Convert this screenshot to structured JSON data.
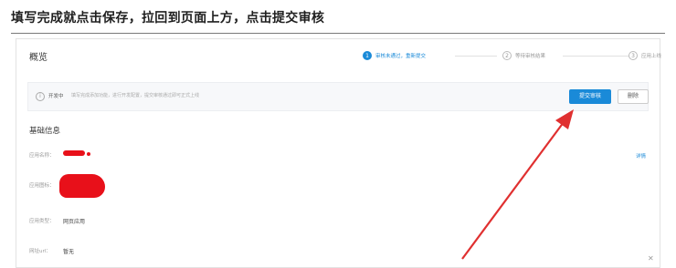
{
  "heading": "填写完成就点击保存，拉回到页面上方，点击提交审核",
  "panel": {
    "title": "概览",
    "steps": [
      {
        "num": "1",
        "label": "审核未通过，重新提交",
        "active": true
      },
      {
        "num": "2",
        "label": "等待审核结果",
        "active": false
      },
      {
        "num": "3",
        "label": "应用上线",
        "active": false
      }
    ],
    "notice": {
      "status": "开发中",
      "text": "填写完成添加功能，进行开发配置，提交审核通过即可正式上线",
      "submit_label": "提交审核",
      "delete_label": "删除"
    },
    "basic_info": {
      "title": "基础信息",
      "edit_label": "详情",
      "fields": [
        {
          "label": "应用名称：",
          "value": ""
        },
        {
          "label": "应用图标：",
          "value": ""
        },
        {
          "label": "应用类型：",
          "value": "网页应用"
        },
        {
          "label": "网址url：",
          "value": "暂无"
        }
      ]
    }
  },
  "colors": {
    "accent": "#1a8ad8",
    "arrow": "#e03030",
    "redaction": "#e8101a"
  },
  "icons": {
    "notice": "info-circle-icon",
    "close": "close-icon"
  }
}
